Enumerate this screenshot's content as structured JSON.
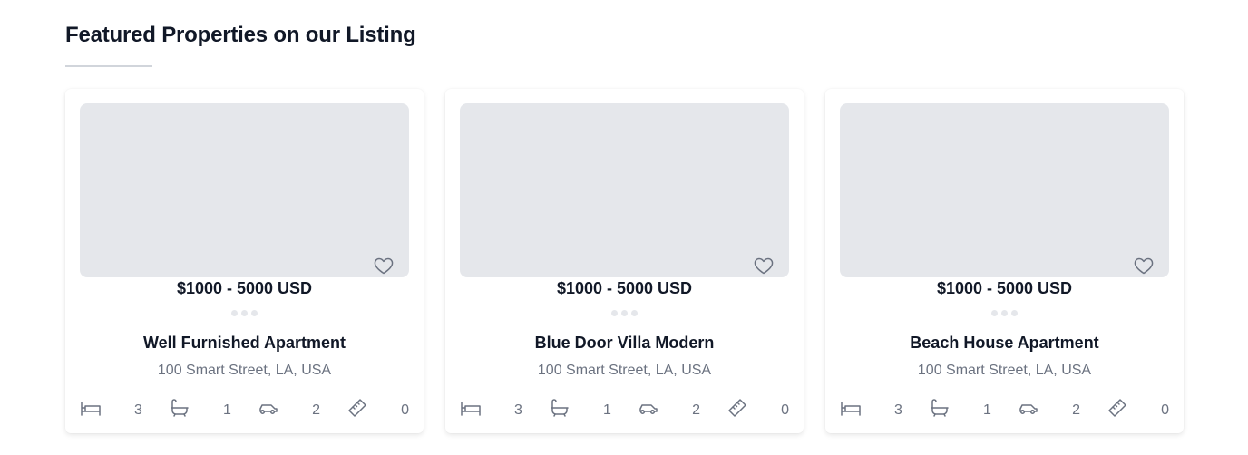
{
  "section": {
    "title": "Featured Properties on our Listing"
  },
  "colors": {
    "placeholder": "#e5e7eb",
    "muted_text": "#6b7280",
    "icon": "#6b7280"
  },
  "listings": [
    {
      "price": "$1000 - 5000 USD",
      "name": "Well Furnished Apartment",
      "address": "100 Smart Street, LA, USA",
      "beds": "3",
      "baths": "1",
      "garage": "2",
      "area": "0"
    },
    {
      "price": "$1000 - 5000 USD",
      "name": "Blue Door Villa Modern",
      "address": "100 Smart Street, LA, USA",
      "beds": "3",
      "baths": "1",
      "garage": "2",
      "area": "0"
    },
    {
      "price": "$1000 - 5000 USD",
      "name": "Beach House Apartment",
      "address": "100 Smart Street, LA, USA",
      "beds": "3",
      "baths": "1",
      "garage": "2",
      "area": "0"
    }
  ],
  "icons": [
    "bed-icon",
    "bath-icon",
    "car-icon",
    "ruler-icon",
    "heart-icon"
  ]
}
